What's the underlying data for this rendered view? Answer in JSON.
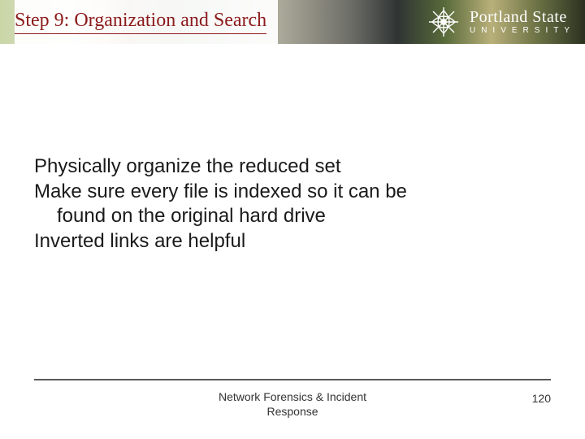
{
  "banner": {
    "university_top": "Portland State",
    "university_bottom": "UNIVERSITY"
  },
  "title": "Step 9: Organization and Search",
  "body": {
    "line1": "Physically organize the reduced set",
    "line2": "Make sure every file is indexed so it can be",
    "line2b": "found on the original hard drive",
    "line3": "Inverted links are helpful"
  },
  "footer": {
    "line1": "Network Forensics & Incident",
    "line2": "Response",
    "page": "120"
  }
}
